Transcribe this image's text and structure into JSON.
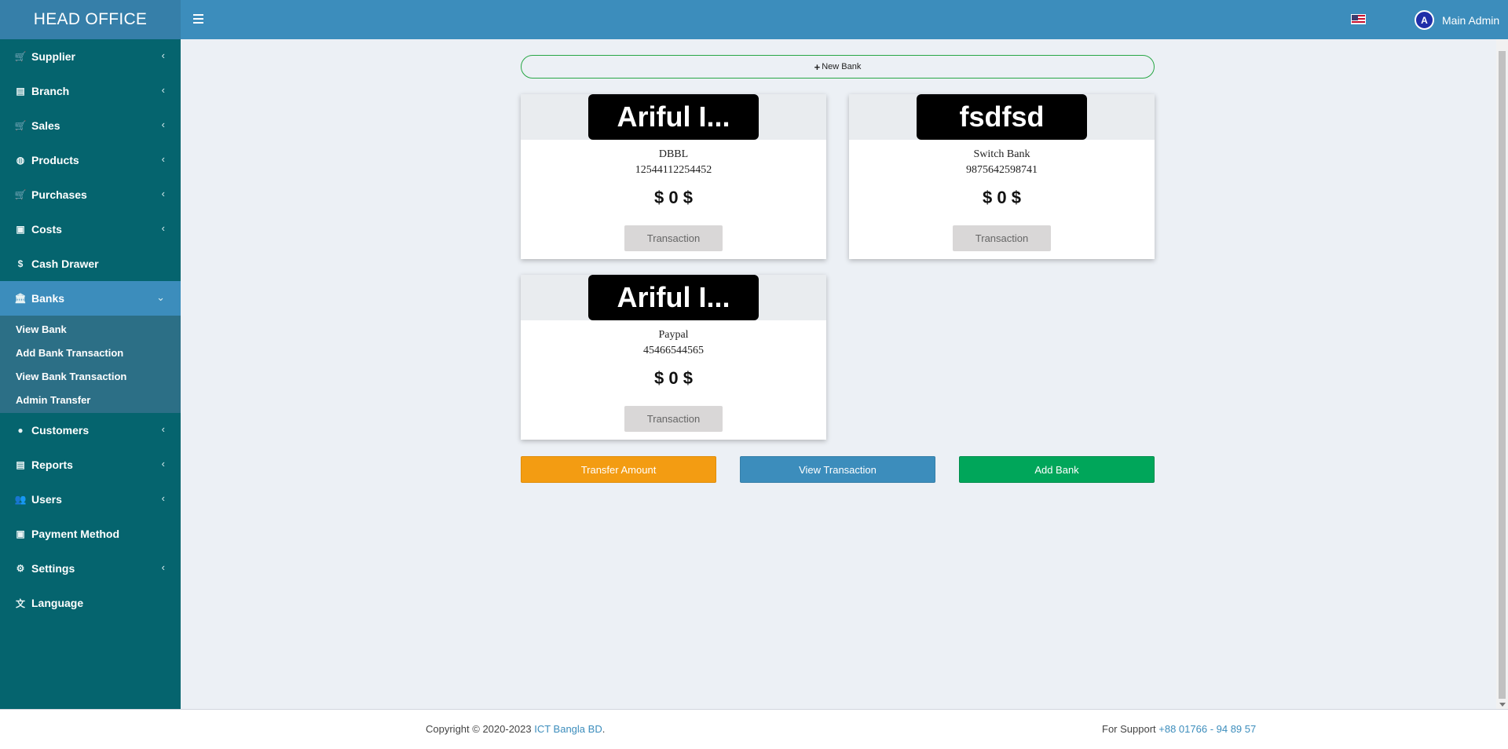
{
  "header": {
    "brand": "HEAD OFFICE",
    "user_name": "Main Admin",
    "avatar_letter": "A"
  },
  "sidebar": {
    "items": [
      {
        "label": "Supplier",
        "icon": "cart-icon"
      },
      {
        "label": "Branch",
        "icon": "file-icon"
      },
      {
        "label": "Sales",
        "icon": "cart-icon"
      },
      {
        "label": "Products",
        "icon": "globe-icon"
      },
      {
        "label": "Purchases",
        "icon": "cart-icon"
      },
      {
        "label": "Costs",
        "icon": "money-icon"
      },
      {
        "label": "Cash Drawer",
        "icon": "dollar-icon"
      },
      {
        "label": "Banks",
        "icon": "bank-icon"
      },
      {
        "label": "Customers",
        "icon": "user-icon"
      },
      {
        "label": "Reports",
        "icon": "file-icon"
      },
      {
        "label": "Users",
        "icon": "users-icon"
      },
      {
        "label": "Payment Method",
        "icon": "money-icon"
      },
      {
        "label": "Settings",
        "icon": "gear-icon"
      },
      {
        "label": "Language",
        "icon": "language-icon"
      }
    ],
    "banks_submenu": [
      "View Bank",
      "Add Bank Transaction",
      "View Bank Transaction",
      "Admin Transfer"
    ]
  },
  "main": {
    "new_bank_label": "New Bank",
    "cards": [
      {
        "logo_text": "Ariful I...",
        "bank_name": "DBBL",
        "account": "12544112254452",
        "balance": "$ 0 $",
        "button": "Transaction"
      },
      {
        "logo_text": "fsdfsd",
        "bank_name": "Switch Bank",
        "account": "9875642598741",
        "balance": "$ 0 $",
        "button": "Transaction"
      },
      {
        "logo_text": "Ariful I...",
        "bank_name": "Paypal",
        "account": "45466544565",
        "balance": "$ 0 $",
        "button": "Transaction"
      }
    ],
    "actions": {
      "transfer": "Transfer Amount",
      "view_transaction": "View Transaction",
      "add_bank": "Add Bank"
    }
  },
  "footer": {
    "copyright_prefix": "Copyright © 2020-2023 ",
    "company": "ICT Bangla BD",
    "copyright_suffix": ".",
    "support_prefix": "For Support ",
    "support_phone": "+88 01766 - 94 89 57"
  },
  "colors": {
    "header": "#3c8dbc",
    "brand": "#367fa9",
    "sidebar": "#05646e",
    "active": "#3c8dbc",
    "orange": "#f39c12",
    "green": "#00a65a"
  }
}
